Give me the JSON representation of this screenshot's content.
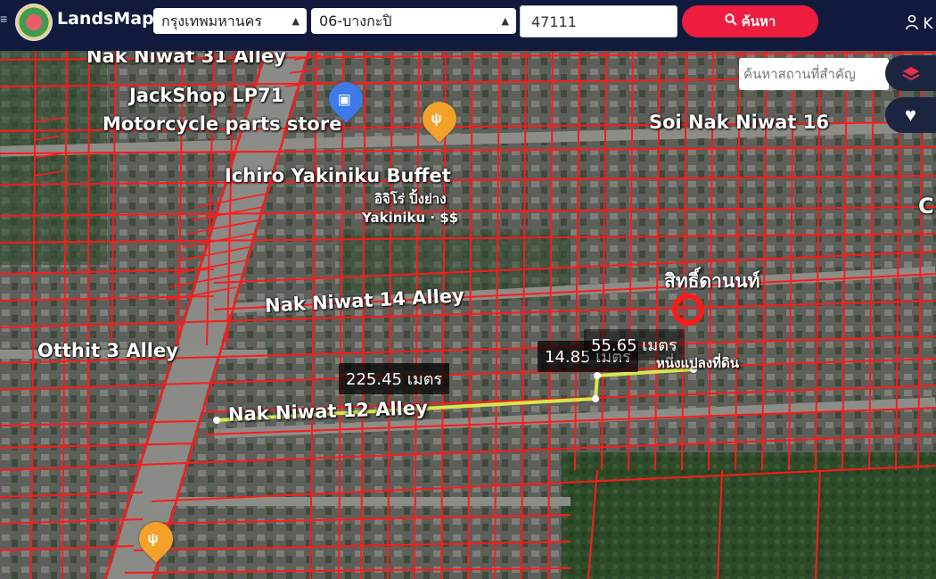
{
  "app": {
    "brand": "LandsMaps"
  },
  "search": {
    "province": "กรุงเทพมหานคร",
    "district": "06-บางกะปิ",
    "parcel_value": "47111",
    "button_label": "ค้นหา"
  },
  "user": {
    "initial": "K"
  },
  "map": {
    "place_search_placeholder": "ค้นหาสถานที่สำคัญ",
    "labels": {
      "nak_niwat_31": "Nak Niwat 31 Alley",
      "jackshop": "JackShop LP71",
      "moto_store": "Motorcycle parts store",
      "soi_16": "Soi Nak Niwat 16",
      "ichiro": "Ichiro Yakiniku Buffet",
      "ichiro_th": "อิจิโร่ ปิ้งย่าง",
      "yakiniku": "Yakiniku · $$",
      "nak_niwat_14": "Nak Niwat 14 Alley",
      "otthit_3": "Otthit 3 Alley",
      "nak_niwat_12": "Nak Niwat 12 Alley",
      "thai_top": "สิทธิ์ดานนท์",
      "parcel_note": "หนึ่งแปลงที่ดิน",
      "right_c": "C"
    },
    "measurements": {
      "m1": "225.45 เมตร",
      "m2": "14.85 เมตร",
      "m3": "55.65 เมตร"
    }
  },
  "colors": {
    "topbar": "#111a3d",
    "search_button": "#ee1c3f",
    "parcel_lines": "#ff1a1a",
    "measure_line": "#d8e84a"
  }
}
